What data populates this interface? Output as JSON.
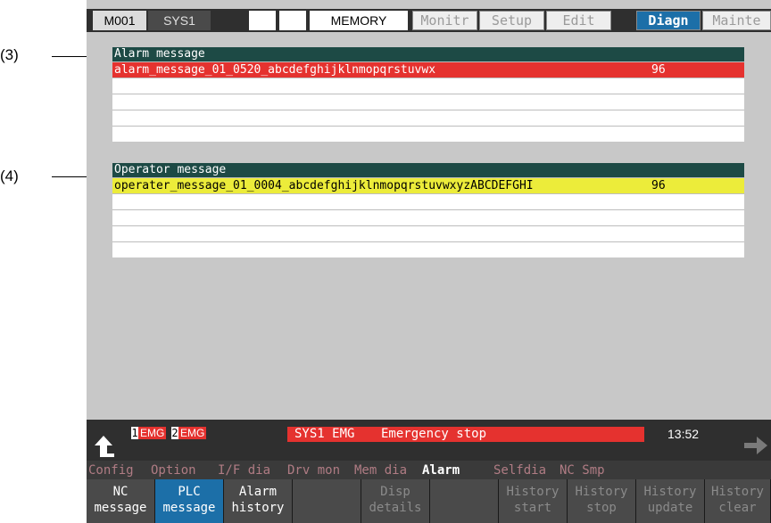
{
  "callouts": {
    "c3": "(3)",
    "c4": "(4)"
  },
  "topbar": {
    "cells": [
      "M001",
      "SYS1",
      "",
      "",
      "MEMORY"
    ],
    "tabs": [
      "Monitr",
      "Setup",
      "Edit",
      "Diagn",
      "Mainte"
    ],
    "active_tab": "Diagn"
  },
  "alarm_panel": {
    "title": "Alarm message",
    "rows": [
      {
        "msg": "alarm_message_01_0520_abcdefghijklnmopqrstuvwx",
        "pct": "96"
      },
      {
        "msg": "",
        "pct": ""
      },
      {
        "msg": "",
        "pct": ""
      },
      {
        "msg": "",
        "pct": ""
      },
      {
        "msg": "",
        "pct": ""
      }
    ]
  },
  "operator_panel": {
    "title": "Operator message",
    "rows": [
      {
        "msg": "operater_message_01_0004_abcdefghijklnmopqrstuvwxyzABCDEFGHI",
        "pct": "96"
      },
      {
        "msg": "",
        "pct": ""
      },
      {
        "msg": "",
        "pct": ""
      },
      {
        "msg": "",
        "pct": ""
      },
      {
        "msg": "",
        "pct": ""
      }
    ]
  },
  "status": {
    "emg1_num": "1",
    "emg1": "EMG",
    "emg2_num": "2",
    "emg2": "EMG",
    "alarm_sys": "SYS1 EMG",
    "alarm_text": "Emergency stop",
    "clock": "13:52"
  },
  "menu_groups": [
    "Config",
    "Option",
    "I/F dia",
    "Drv mon",
    "Mem dia",
    "Alarm",
    "Selfdia",
    "NC Smp"
  ],
  "softkeys": [
    {
      "l1": "NC",
      "l2": "message"
    },
    {
      "l1": "PLC",
      "l2": "message"
    },
    {
      "l1": "Alarm",
      "l2": "history"
    },
    {
      "l1": "",
      "l2": ""
    },
    {
      "l1": "Disp",
      "l2": "details"
    },
    {
      "l1": "",
      "l2": ""
    },
    {
      "l1": "History",
      "l2": "start"
    },
    {
      "l1": "History",
      "l2": "stop"
    },
    {
      "l1": "History",
      "l2": "update"
    },
    {
      "l1": "History",
      "l2": "clear"
    }
  ],
  "colors": {
    "accent": "#1c6fa8",
    "alarm": "#e5322f",
    "operator": "#ecec3a",
    "panel_head": "#1d4a45"
  }
}
